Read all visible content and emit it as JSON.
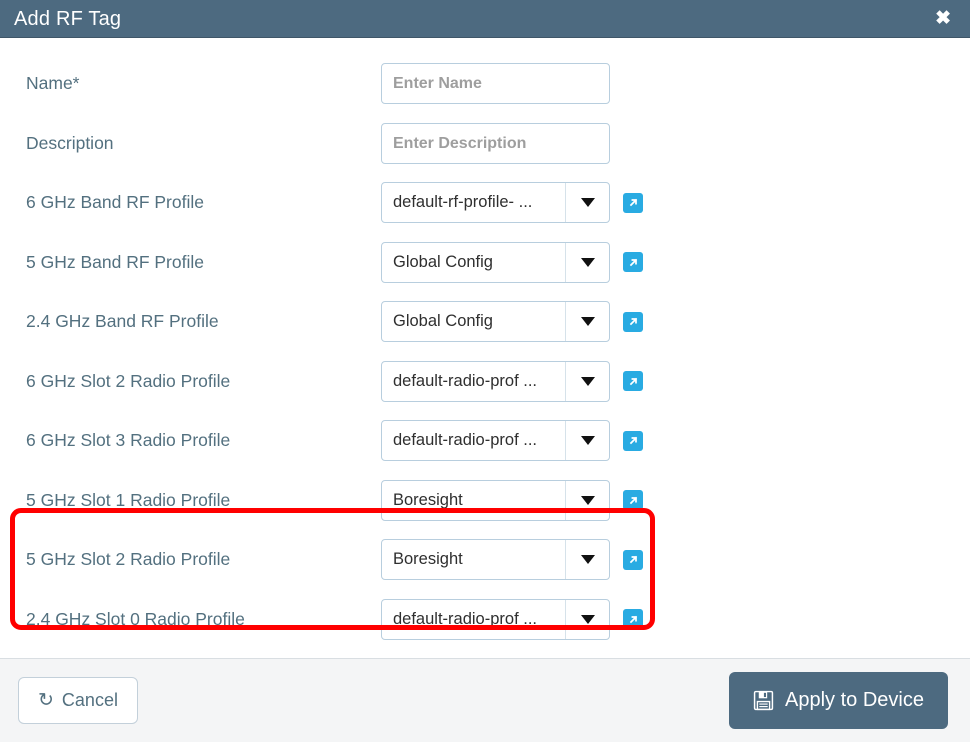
{
  "dialog": {
    "title": "Add RF Tag",
    "close_icon": "close-icon",
    "header_bg": "#4d6a80"
  },
  "form": {
    "rows": [
      {
        "label": "Name*",
        "type": "text",
        "value": "",
        "placeholder": "Enter Name",
        "has_link": false
      },
      {
        "label": "Description",
        "type": "text",
        "value": "",
        "placeholder": "Enter Description",
        "has_link": false
      },
      {
        "label": "6 GHz Band RF Profile",
        "type": "select",
        "value": "default-rf-profile- ...",
        "has_link": true
      },
      {
        "label": "5 GHz Band RF Profile",
        "type": "select",
        "value": "Global Config",
        "has_link": true
      },
      {
        "label": "2.4 GHz Band RF Profile",
        "type": "select",
        "value": "Global Config",
        "has_link": true
      },
      {
        "label": "6 GHz Slot 2 Radio Profile",
        "type": "select",
        "value": "default-radio-prof ...",
        "has_link": true
      },
      {
        "label": "6 GHz Slot 3 Radio Profile",
        "type": "select",
        "value": "default-radio-prof ...",
        "has_link": true
      },
      {
        "label": "5 GHz Slot 1 Radio Profile",
        "type": "select",
        "value": "Boresight",
        "has_link": true
      },
      {
        "label": "5 GHz Slot 2 Radio Profile",
        "type": "select",
        "value": "Boresight",
        "has_link": true
      },
      {
        "label": "2.4 GHz Slot 0 Radio Profile",
        "type": "select",
        "value": "default-radio-prof ...",
        "has_link": true
      }
    ],
    "link_icon": "external-link-icon",
    "caret_icon": "chevron-down-icon"
  },
  "annotation": {
    "color": "#ff0000",
    "note": "red-highlight-around-5ghz-slot-1-and-slot-2-radio-profile-rows"
  },
  "footer": {
    "cancel_label": "Cancel",
    "cancel_icon": "undo-icon",
    "apply_label": "Apply to Device",
    "apply_icon": "save-icon",
    "apply_bg": "#4d6a80"
  }
}
